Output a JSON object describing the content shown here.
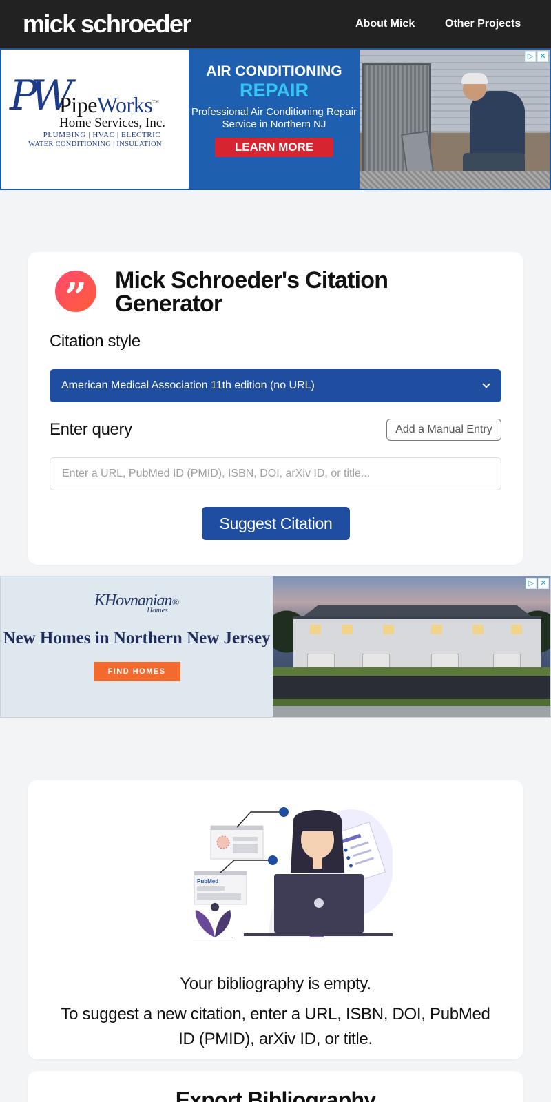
{
  "header": {
    "brand": "mick schroeder",
    "nav": {
      "about": "About Mick",
      "other": "Other Projects"
    },
    "background": "#222222"
  },
  "ad_top": {
    "logo_monogram": "PW",
    "logo_name_a": "Pipe",
    "logo_name_b": "Works",
    "logo_tm": "™",
    "logo_sub": "Home Services, Inc.",
    "logo_services_1": "PLUMBING | HVAC | ELECTRIC",
    "logo_services_2": "WATER CONDITIONING | INSULATION",
    "headline_1": "AIR CONDITIONING",
    "headline_2": "REPAIR",
    "body": "Professional Air Conditioning Repair Service in Northern NJ",
    "cta": "LEARN MORE",
    "adchoices_icon": "▷",
    "close_icon": "✕"
  },
  "generator": {
    "badge_glyph": "”",
    "title": "Mick Schroeder's Citation Generator",
    "style_label": "Citation style",
    "style_selected": "American Medical Association 11th edition (no URL)",
    "query_label": "Enter query",
    "manual_button": "Add a Manual Entry",
    "query_placeholder": "Enter a URL, PubMed ID (PMID), ISBN, DOI, arXiv ID, or title...",
    "suggest_button": "Suggest Citation",
    "accent": "#1f4ea0"
  },
  "ad_mid": {
    "logo": "KHovnanian",
    "logo_reg": "®",
    "logo_homes": "Homes",
    "headline": "New Homes in Northern New Jersey",
    "cta": "FIND HOMES",
    "adchoices_icon": "▷",
    "close_icon": "✕"
  },
  "bibliography": {
    "illustration_label": "PubMed",
    "empty_title": "Your bibliography is empty.",
    "hint": "To suggest a new citation, enter a URL, ISBN, DOI, PubMed ID (PMID), arXiv ID, or title."
  },
  "export": {
    "title": "Export Bibliography"
  }
}
